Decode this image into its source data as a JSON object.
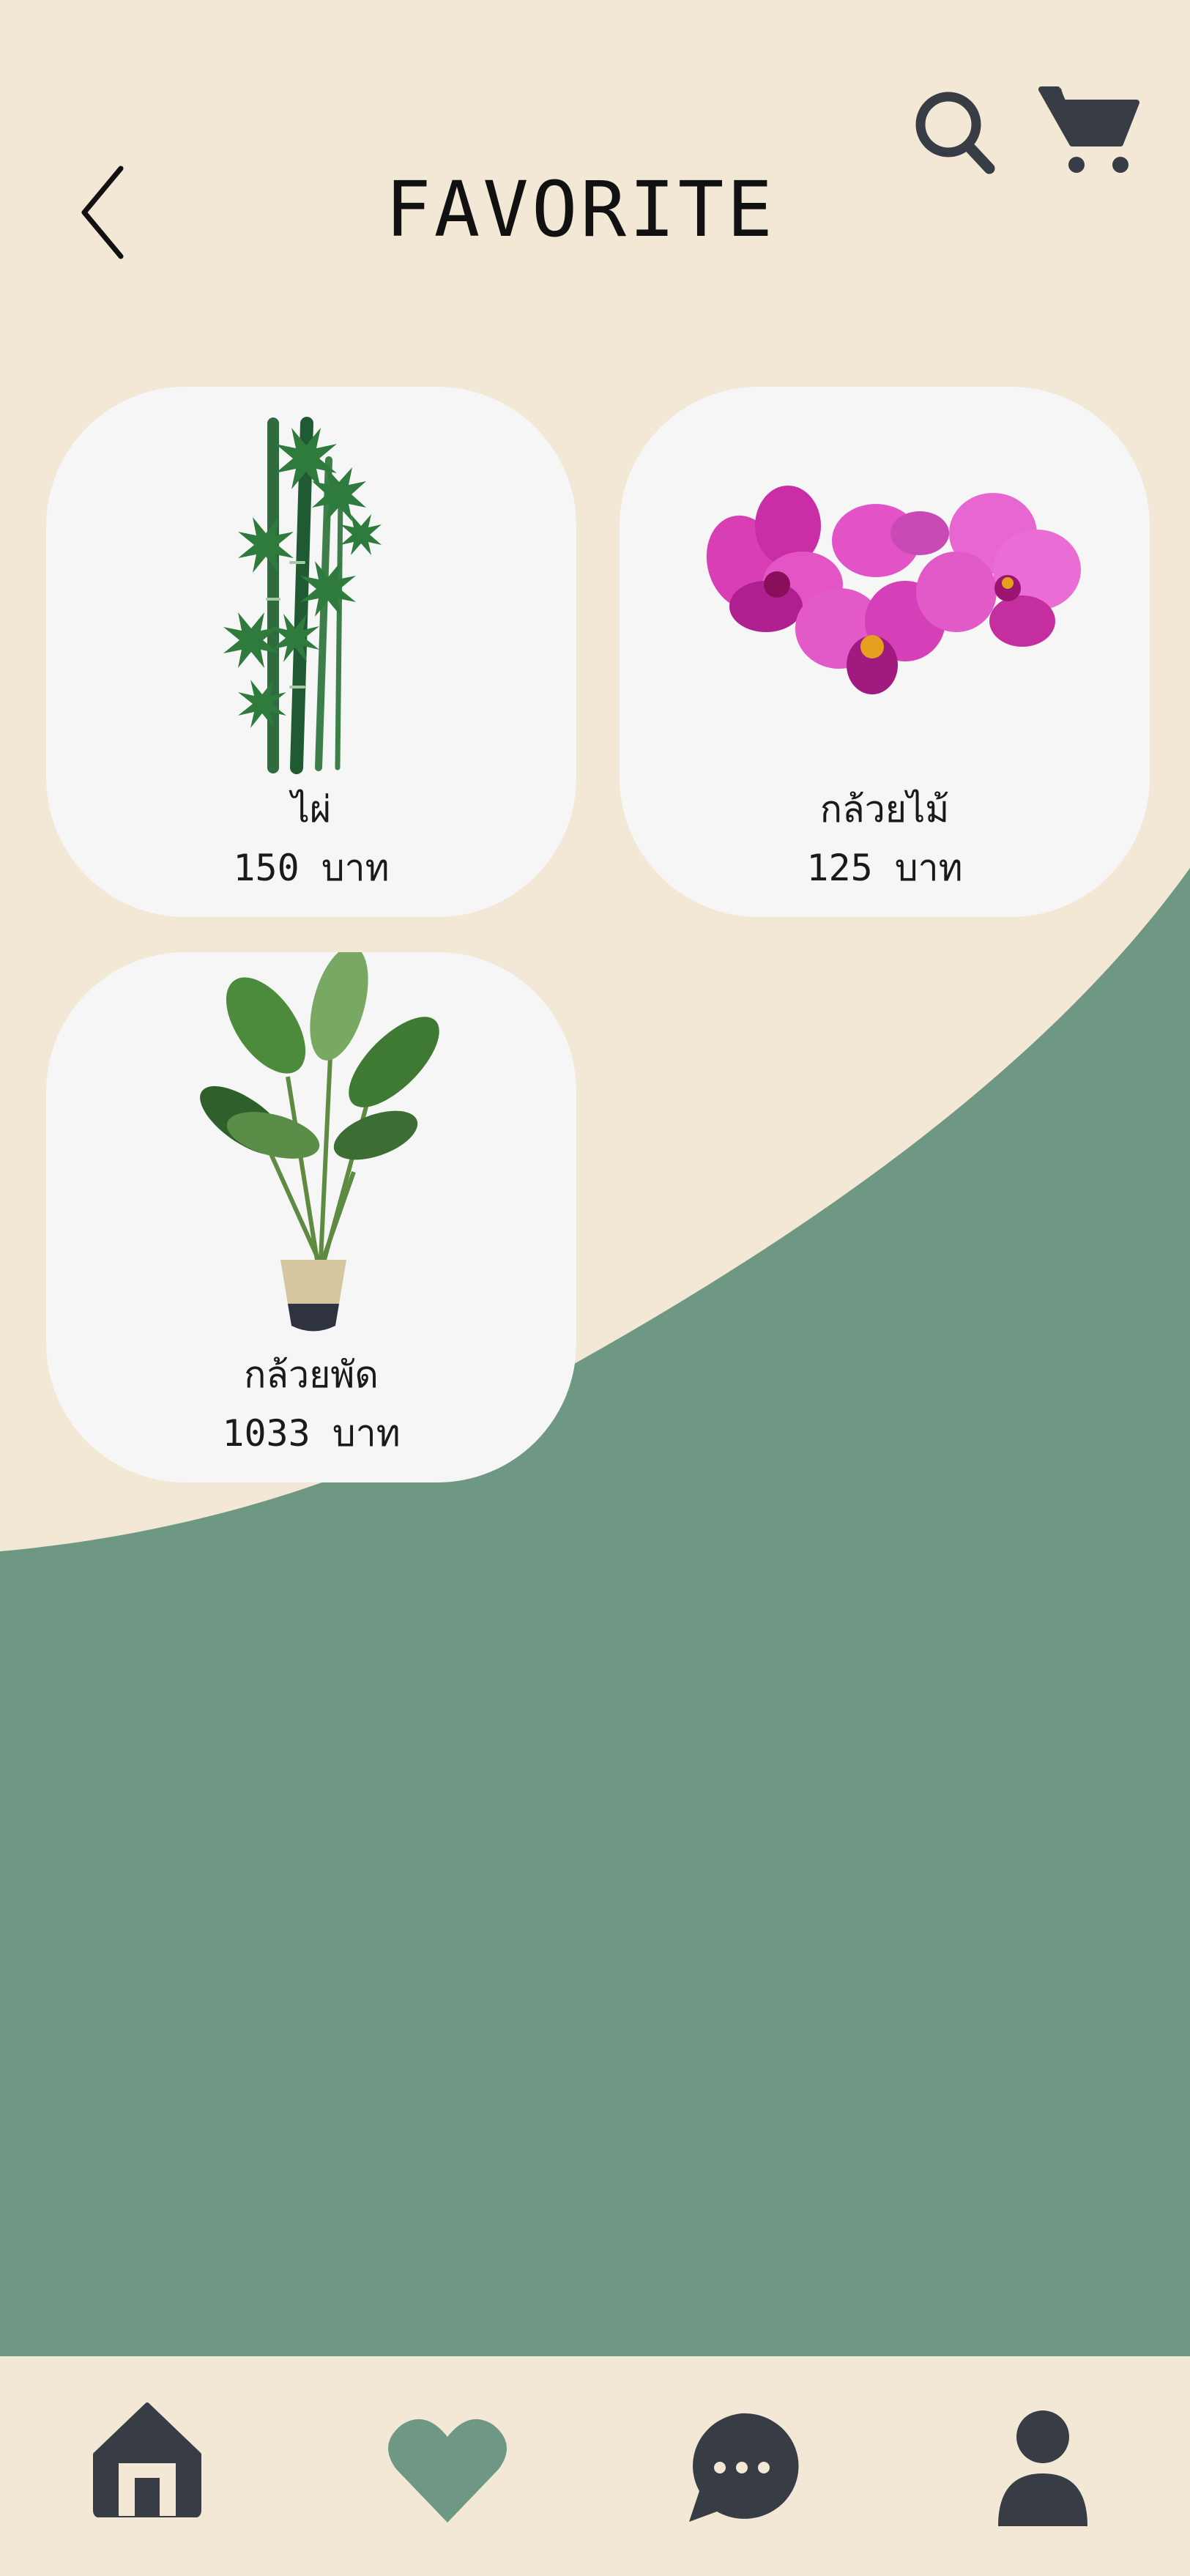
{
  "header": {
    "title": "FAVORITE",
    "back_icon": "chevron-left-icon",
    "search_icon": "search-icon",
    "cart_icon": "cart-icon"
  },
  "favorites": [
    {
      "name": "ไผ่",
      "price": "150",
      "unit": "บาท",
      "image": "bamboo"
    },
    {
      "name": "กล้วยไม้",
      "price": "125",
      "unit": "บาท",
      "image": "orchid"
    },
    {
      "name": "กล้วยพัด",
      "price": "1033",
      "unit": "บาท",
      "image": "travelers-palm"
    }
  ],
  "bottom_nav": {
    "items": [
      {
        "icon": "home-icon",
        "active": false
      },
      {
        "icon": "heart-icon",
        "active": true
      },
      {
        "icon": "chat-icon",
        "active": false
      },
      {
        "icon": "profile-icon",
        "active": false
      }
    ]
  },
  "colors": {
    "cream": "#f3e7d6",
    "green": "#6e9784",
    "card": "#f6f6f6",
    "icon_dark": "#383c45"
  }
}
